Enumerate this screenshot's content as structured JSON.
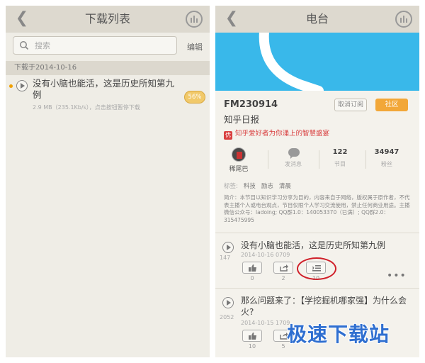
{
  "left": {
    "title": "下载列表",
    "search_placeholder": "搜索",
    "edit_label": "编辑",
    "section_header": "下载于2014-10-16",
    "items": [
      {
        "title": "没有小脑也能活，这是历史所知第九例",
        "meta": "2.9 MB（235.1Kb/s），点击按钮暂停下载",
        "progress_label": "56%",
        "progress": 0.56
      }
    ]
  },
  "right": {
    "title": "电台",
    "channel": {
      "id": "FM230914",
      "name": "知乎日报",
      "badge": "优",
      "slogan": "知乎爱好者为你涌上的智慧盛宴",
      "unsubscribe_label": "取消订阅",
      "community_label": "社区"
    },
    "stats": {
      "host_name": "稀尾巴",
      "messages_label": "发消息",
      "episodes_value": "122",
      "episodes_label": "节目",
      "fans_value": "34947",
      "fans_label": "粉丝"
    },
    "tags_label": "标签:",
    "tags": [
      "科技",
      "励志",
      "清晨"
    ],
    "description": "简介：本节目以知识学习分享为目的，内容来自于网络，版权属于原作者，不代表主播个人或电台观点，节目仅限个人学习交流使用，禁止任何商业用途。主播微信公众号：ladoing; QQ群1.0：140053370（已满）; QQ群2.0：315475995",
    "episodes": [
      {
        "title": "没有小脑也能活，这是历史所知第九例",
        "plays": "147",
        "date": "2014-10-16 0709",
        "likes": "0",
        "shares": "2",
        "downloads": "10"
      },
      {
        "title": "那么问题来了：【学挖掘机哪家强】为什么会火?",
        "plays": "2052",
        "date": "2014-10-15 1709",
        "likes": "10",
        "shares": "5",
        "downloads": ""
      }
    ]
  },
  "watermark": "极速下载站",
  "colors": {
    "accent_orange": "#f2a738",
    "cover_blue": "#39b8ea",
    "highlight_red": "#d0202a",
    "topbar": "#ddd9cf"
  },
  "icons": [
    "back-chevron-icon",
    "equalizer-icon",
    "search-icon",
    "play-icon",
    "thumbs-up-icon",
    "share-icon",
    "download-list-icon",
    "more-icon",
    "chat-bubble-icon"
  ]
}
